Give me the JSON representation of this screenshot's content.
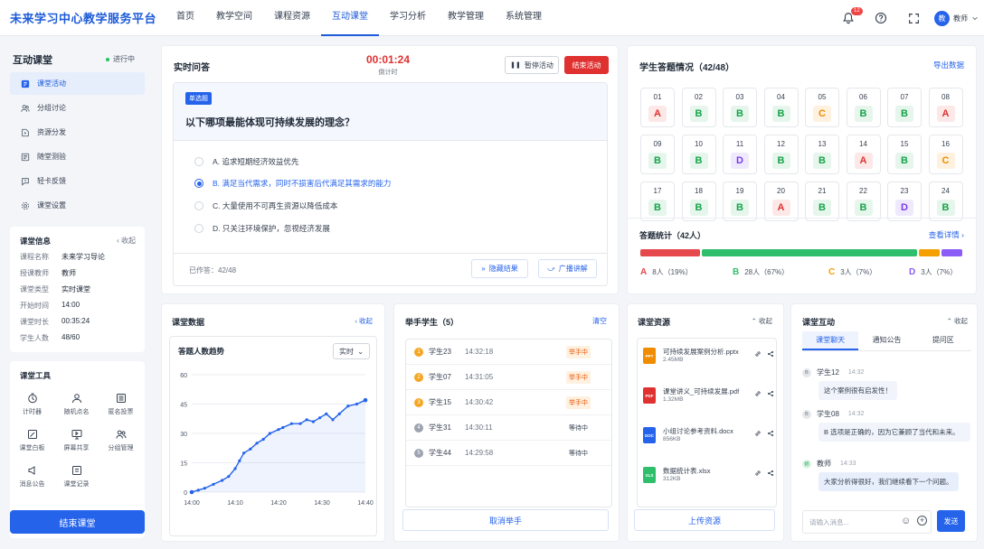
{
  "app": {
    "title": "未来学习中心教学服务平台"
  },
  "nav": [
    {
      "label": "首页"
    },
    {
      "label": "教学空间"
    },
    {
      "label": "课程资源"
    },
    {
      "label": "互动课堂",
      "active": true
    },
    {
      "label": "学习分析"
    },
    {
      "label": "教学管理"
    },
    {
      "label": "系统管理"
    }
  ],
  "header": {
    "notif_count": "12",
    "user_avatar": "教",
    "user_name": "教师"
  },
  "sidebar": {
    "title": "互动课堂",
    "status": "进行中",
    "menu": [
      {
        "label": "课堂活动",
        "icon": "activity-icon",
        "active": true
      },
      {
        "label": "分组讨论",
        "icon": "group-icon"
      },
      {
        "label": "资源分发",
        "icon": "share-icon"
      },
      {
        "label": "随堂测验",
        "icon": "quiz-icon"
      },
      {
        "label": "轻卡反馈",
        "icon": "feedback-icon"
      },
      {
        "label": "课堂设置",
        "icon": "gear-icon"
      }
    ],
    "info": {
      "title": "课堂信息",
      "collapse": "收起",
      "rows": [
        {
          "k": "课程名称",
          "v": "未来学习导论"
        },
        {
          "k": "授课教师",
          "v": "教师"
        },
        {
          "k": "课堂类型",
          "v": "实时课堂"
        },
        {
          "k": "开始时间",
          "v": "14:00"
        },
        {
          "k": "课堂时长",
          "v": "00:35:24"
        },
        {
          "k": "学生人数",
          "v": "48/60"
        }
      ]
    },
    "tools": {
      "title": "课堂工具",
      "items": [
        {
          "label": "计时器",
          "icon": "timer-icon"
        },
        {
          "label": "随机点名",
          "icon": "random-name-icon"
        },
        {
          "label": "匿名投票",
          "icon": "vote-icon"
        },
        {
          "label": "课堂白板",
          "icon": "whiteboard-icon"
        },
        {
          "label": "屏幕共享",
          "icon": "screen-share-icon"
        },
        {
          "label": "分组管理",
          "icon": "group-manage-icon"
        },
        {
          "label": "消息公告",
          "icon": "announce-icon"
        },
        {
          "label": "课堂记录",
          "icon": "record-icon"
        }
      ]
    },
    "end_button": "结束课堂"
  },
  "quiz": {
    "title": "实时问答",
    "timer": "00:01:24",
    "timer_label": "倒计时",
    "pause": "暂停活动",
    "end": "结束活动",
    "tag": "单选题",
    "question": "以下哪项最能体现可持续发展的理念？",
    "options": [
      {
        "text": "A. 追求短期经济效益优先",
        "selected": false
      },
      {
        "text": "B. 满足当代需求，同时不损害后代满足其需求的能力",
        "selected": true
      },
      {
        "text": "C. 大量使用不可再生资源以降低成本",
        "selected": false
      },
      {
        "text": "D. 只关注环境保护，忽视经济发展",
        "selected": false
      }
    ],
    "answered": "已作答：42/48",
    "hide_result": "隐藏结果",
    "broadcast": "广播讲解"
  },
  "answers": {
    "title": "学生答题情况（42/48）",
    "export": "导出数据",
    "students": [
      {
        "no": "01",
        "ans": "A"
      },
      {
        "no": "02",
        "ans": "B"
      },
      {
        "no": "03",
        "ans": "B"
      },
      {
        "no": "04",
        "ans": "B"
      },
      {
        "no": "05",
        "ans": "C"
      },
      {
        "no": "06",
        "ans": "B"
      },
      {
        "no": "07",
        "ans": "B"
      },
      {
        "no": "08",
        "ans": "A"
      },
      {
        "no": "09",
        "ans": "B"
      },
      {
        "no": "10",
        "ans": "B"
      },
      {
        "no": "11",
        "ans": "D"
      },
      {
        "no": "12",
        "ans": "B"
      },
      {
        "no": "13",
        "ans": "B"
      },
      {
        "no": "14",
        "ans": "A"
      },
      {
        "no": "15",
        "ans": "B"
      },
      {
        "no": "16",
        "ans": "C"
      },
      {
        "no": "17",
        "ans": "B"
      },
      {
        "no": "18",
        "ans": "B"
      },
      {
        "no": "19",
        "ans": "B"
      },
      {
        "no": "20",
        "ans": "A"
      },
      {
        "no": "21",
        "ans": "B"
      },
      {
        "no": "22",
        "ans": "B"
      },
      {
        "no": "23",
        "ans": "D"
      },
      {
        "no": "24",
        "ans": "B"
      }
    ],
    "stats_title": "答题统计（42人）",
    "details": "查看详情",
    "stats": [
      {
        "letter": "A",
        "count": "8人",
        "pct": "（19%）",
        "fraction": 0.19,
        "color": "#e5484d"
      },
      {
        "letter": "B",
        "count": "28人",
        "pct": "（67%）",
        "fraction": 0.67,
        "color": "#2fbf6c"
      },
      {
        "letter": "C",
        "count": "3人",
        "pct": "（7%）",
        "fraction": 0.07,
        "color": "#f59f00"
      },
      {
        "letter": "D",
        "count": "3人",
        "pct": "（7%）",
        "fraction": 0.07,
        "color": "#8b5cf6"
      }
    ]
  },
  "classdata": {
    "title": "课堂数据",
    "collapse": "收起",
    "chart_title": "答题人数趋势",
    "range": "实时"
  },
  "chart_data": {
    "type": "line",
    "title": "答题人数趋势",
    "xlabel": "",
    "ylabel": "",
    "x_ticks": [
      "14:00",
      "14:10",
      "14:20",
      "14:30",
      "14:40"
    ],
    "y_ticks": [
      0,
      15,
      30,
      45,
      60
    ],
    "xlim": [
      0,
      40
    ],
    "ylim": [
      0,
      60
    ],
    "grid": true,
    "x": [
      0,
      1.5,
      3,
      5,
      7,
      8.5,
      10,
      11,
      12,
      13.5,
      15,
      16.5,
      18,
      20,
      21,
      23,
      25,
      26.5,
      28,
      29.5,
      31,
      32.5,
      34,
      36,
      38,
      40
    ],
    "y": [
      0,
      1,
      2,
      4,
      6,
      8,
      12,
      16,
      20,
      22,
      25,
      27,
      30,
      32,
      33,
      35,
      35,
      37,
      36,
      38,
      40,
      37,
      40,
      44,
      45,
      47
    ]
  },
  "raise_hand": {
    "title": "举手学生（5）",
    "clear": "清空",
    "rows": [
      {
        "idx": "1",
        "name": "学生23",
        "time": "14:32:18",
        "status": "举手中",
        "active": true
      },
      {
        "idx": "2",
        "name": "学生07",
        "time": "14:31:05",
        "status": "举手中",
        "active": true
      },
      {
        "idx": "3",
        "name": "学生15",
        "time": "14:30:42",
        "status": "举手中",
        "active": true
      },
      {
        "idx": "4",
        "name": "学生31",
        "time": "14:30:11",
        "status": "等待中",
        "active": false
      },
      {
        "idx": "5",
        "name": "学生44",
        "time": "14:29:58",
        "status": "等待中",
        "active": false
      }
    ],
    "cancel": "取消举手"
  },
  "resources": {
    "title": "课堂资源",
    "collapse": "收起",
    "files": [
      {
        "name": "可持续发展案例分析.pptx",
        "size": "2.45MB",
        "type": "PPT",
        "color": "#f08c00"
      },
      {
        "name": "课堂讲义_可持续发展.pdf",
        "size": "1.32MB",
        "type": "PDF",
        "color": "#e03131"
      },
      {
        "name": "小组讨论参考资料.docx",
        "size": "856KB",
        "type": "DOC",
        "color": "#2563eb"
      },
      {
        "name": "数据统计表.xlsx",
        "size": "312KB",
        "type": "XLS",
        "color": "#2fbf6c"
      }
    ],
    "upload": "上传资源"
  },
  "interaction": {
    "title": "课堂互动",
    "collapse": "收起",
    "tabs": [
      "课堂聊天",
      "通知公告",
      "提问区"
    ],
    "messages": [
      {
        "avatar": "B",
        "name": "学生12",
        "time": "14:32",
        "text": "这个案例很有启发性！"
      },
      {
        "avatar": "B",
        "name": "学生08",
        "time": "14:32",
        "text": "B 选项是正确的，因为它兼顾了当代和未来。"
      },
      {
        "avatar": "师",
        "name": "教师",
        "time": "14:33",
        "text": "大家分析得很好，我们继续看下一个问题。"
      }
    ],
    "input_placeholder": "请输入消息...",
    "send": "发送"
  }
}
